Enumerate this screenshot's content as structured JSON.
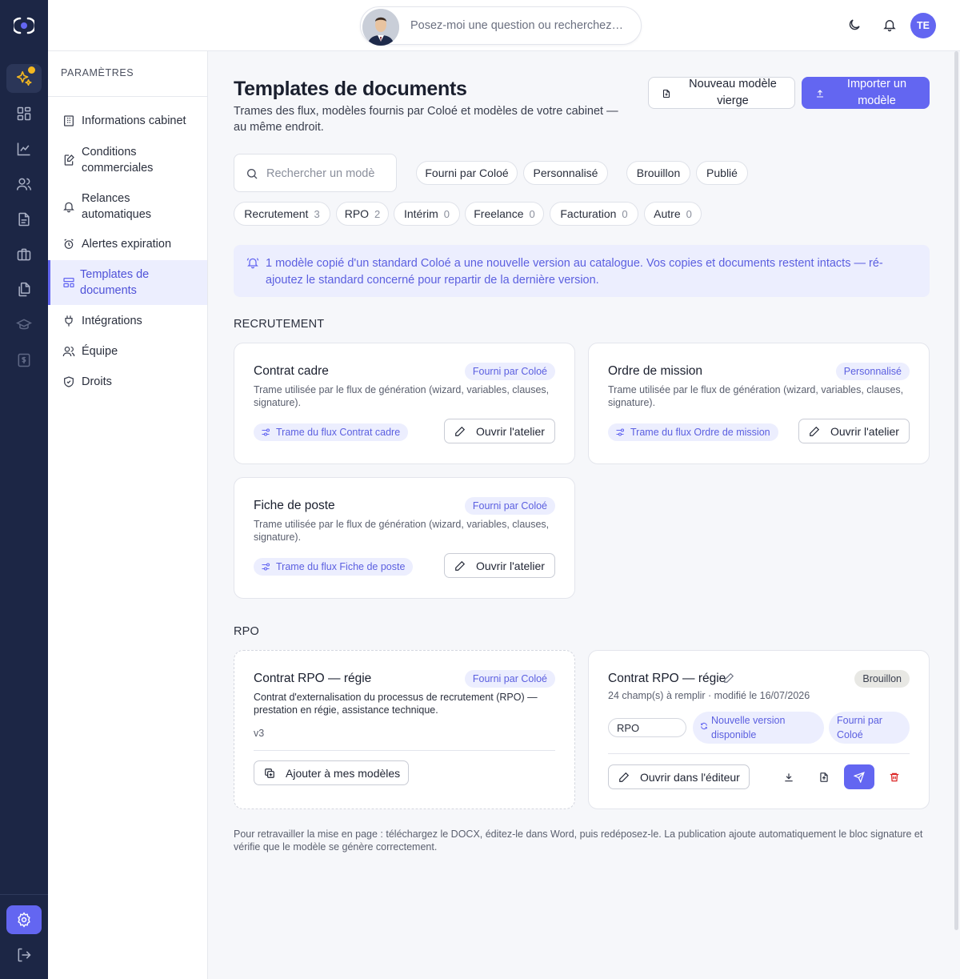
{
  "topbar": {
    "search_placeholder": "Posez-moi une question ou recherchez…",
    "user_initials": "TE"
  },
  "sidebar": {
    "heading": "PARAMÈTRES",
    "items": [
      {
        "label": "Informations cabinet",
        "icon": "building-icon"
      },
      {
        "label": "Conditions commerciales",
        "icon": "file-edit-icon"
      },
      {
        "label": "Relances automatiques",
        "icon": "bell-icon"
      },
      {
        "label": "Alertes expiration",
        "icon": "alarm-clock-icon"
      },
      {
        "label": "Templates de documents",
        "icon": "layout-template-icon",
        "active": true
      },
      {
        "label": "Intégrations",
        "icon": "plug-icon"
      },
      {
        "label": "Équipe",
        "icon": "users-icon"
      },
      {
        "label": "Droits",
        "icon": "shield-icon"
      }
    ]
  },
  "page": {
    "title": "Templates de documents",
    "subtitle": "Trames des flux, modèles fournis par Coloé et modèles de votre cabinet — au même endroit.",
    "new_button": "Nouveau modèle vierge",
    "import_button": "Importer un modèle",
    "search_placeholder": "Rechercher un modèle"
  },
  "filters": {
    "source": [
      "Fourni par Coloé",
      "Personnalisé"
    ],
    "status": [
      "Brouillon",
      "Publié"
    ],
    "categories": [
      {
        "label": "Recrutement",
        "count": "3"
      },
      {
        "label": "RPO",
        "count": "2"
      },
      {
        "label": "Intérim",
        "count": "0"
      },
      {
        "label": "Freelance",
        "count": "0"
      },
      {
        "label": "Facturation",
        "count": "0"
      },
      {
        "label": "Autre",
        "count": "0"
      }
    ]
  },
  "notice": "1 modèle copié d'un standard Coloé a une nouvelle version au catalogue. Vos copies et documents restent intacts — ré-ajoutez le standard concerné pour repartir de la dernière version.",
  "sections": {
    "recrutement": {
      "title": "RECRUTEMENT",
      "cards": [
        {
          "title": "Contrat cadre",
          "badge": "Fourni par Coloé",
          "desc": "Trame utilisée par le flux de génération (wizard, variables, clauses, signature).",
          "flow": "Trame du flux Contrat cadre",
          "action": "Ouvrir l'atelier"
        },
        {
          "title": "Ordre de mission",
          "badge": "Personnalisé",
          "desc": "Trame utilisée par le flux de génération (wizard, variables, clauses, signature).",
          "flow": "Trame du flux Ordre de mission",
          "action": "Ouvrir l'atelier"
        },
        {
          "title": "Fiche de poste",
          "badge": "Fourni par Coloé",
          "desc": "Trame utilisée par le flux de génération (wizard, variables, clauses, signature).",
          "flow": "Trame du flux Fiche de poste",
          "action": "Ouvrir l'atelier"
        }
      ]
    },
    "rpo": {
      "title": "RPO",
      "catalog_card": {
        "title": "Contrat RPO — régie",
        "badge": "Fourni par Coloé",
        "desc": "Contrat d'externalisation du processus de recrutement (RPO) — prestation en régie, assistance technique.",
        "version": "v3",
        "action": "Ajouter à mes modèles"
      },
      "own_card": {
        "title": "Contrat RPO — régie",
        "status": "Brouillon",
        "meta": "24 champ(s) à remplir · modifié le 16/07/2026",
        "category": "RPO",
        "update_tag": "Nouvelle version disponible",
        "source_tag": "Fourni par Coloé",
        "action": "Ouvrir dans l'éditeur"
      }
    }
  },
  "footnote": "Pour retravailler la mise en page : téléchargez le DOCX, éditez-le dans Word, puis redéposez-le. La publication ajoute automatiquement le bloc signature et vérifie que le modèle se génère correctement.",
  "colors": {
    "accent": "#6366f1",
    "rail": "#1c2645",
    "notification_dot": "#f5b820",
    "danger": "#dc2626"
  }
}
